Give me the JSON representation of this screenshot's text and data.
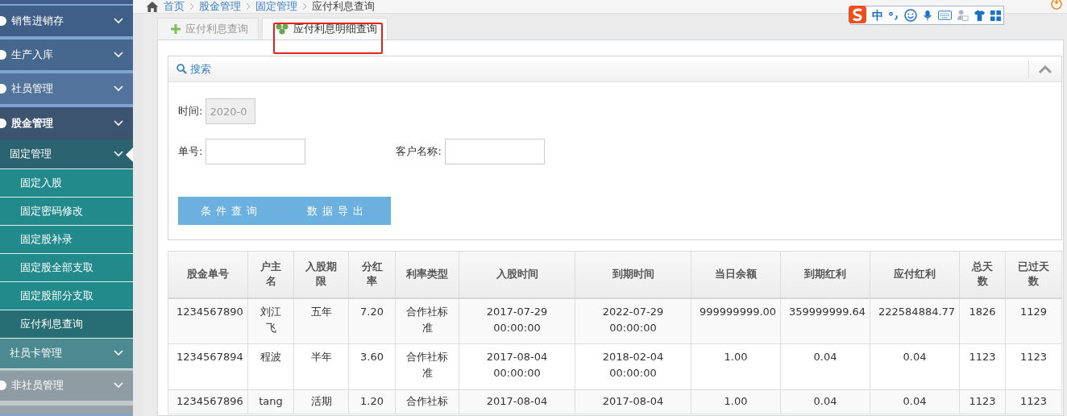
{
  "sidebar": {
    "items": [
      {
        "label": "销售进销存"
      },
      {
        "label": "生产入库"
      },
      {
        "label": "社员管理"
      },
      {
        "label": "股金管理",
        "children": [
          {
            "label": "固定管理",
            "children": [
              {
                "label": "固定入股",
                "selected": false
              },
              {
                "label": "固定密码修改",
                "selected": false
              },
              {
                "label": "固定股补录",
                "selected": false
              },
              {
                "label": "固定股全部支取",
                "selected": false
              },
              {
                "label": "固定股部分支取",
                "selected": false
              },
              {
                "label": "应付利息查询",
                "selected": true
              }
            ]
          },
          {
            "label": "社员卡管理"
          }
        ]
      },
      {
        "label": "非社员管理"
      }
    ]
  },
  "breadcrumb": [
    "首页",
    "股金管理",
    "固定管理",
    "应付利息查询"
  ],
  "ime_toolbar": {
    "mode": "中"
  },
  "tabs": [
    {
      "label": "应付利息查询",
      "selected": false
    },
    {
      "label": "应付利息明细查询",
      "selected": true
    }
  ],
  "search_panel": {
    "title": "搜索",
    "time_label": "时间:",
    "time_value": "2020-0",
    "number_label": "单号:",
    "customer_label": "客户名称:",
    "buttons": [
      "条件查询",
      "数据导出"
    ]
  },
  "table": {
    "columns": [
      "股金单号",
      "户主名",
      "入股期限",
      "分红率",
      "利率类型",
      "入股时间",
      "到期时间",
      "当日余额",
      "到期红利",
      "应付红利",
      "总天数",
      "已过天数"
    ],
    "rows": [
      [
        "1234567890",
        "刘江飞",
        "五年",
        "7.20",
        "合作社标准",
        "2017-07-29 00:00:00",
        "2022-07-29 00:00:00",
        "999999999.00",
        "359999999.64",
        "222584884.77",
        "1826",
        "1129"
      ],
      [
        "1234567894",
        "程波",
        "半年",
        "3.60",
        "合作社标准",
        "2017-08-04 00:00:00",
        "2018-02-04 00:00:00",
        "1.00",
        "0.04",
        "0.04",
        "1123",
        "1123"
      ],
      [
        "1234567896",
        "tang",
        "活期",
        "1.20",
        "合作社标",
        "2017-08-04",
        "2017-08-04",
        "1.00",
        "0.04",
        "0.04",
        "1123",
        "1123"
      ]
    ]
  }
}
